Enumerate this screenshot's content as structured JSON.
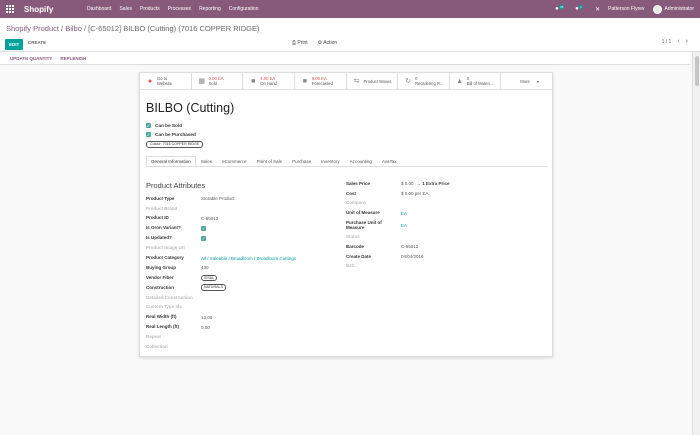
{
  "navbar": {
    "brand": "Shopify",
    "menu": [
      "Dashboard",
      "Sales",
      "Products",
      "Processes",
      "Reporting",
      "Configuration"
    ],
    "messages_count": "26",
    "activities_count": "1",
    "company": "Patterson Flyrev",
    "user": "Administrator"
  },
  "breadcrumb": {
    "root": "Shopify Product",
    "sep1": " / ",
    "parent": "Bilbo",
    "sep2": " / ",
    "current": "[C-65012] BILBO (Cutting) (7016 COPPER RIDGE)"
  },
  "toolbar": {
    "edit_label": "EDIT",
    "create_label": "CREATE",
    "print_label": "Print",
    "action_label": "Action",
    "pager": "1 / 1"
  },
  "statusbar": {
    "update_quantity": "UPDATE QUANTITY",
    "replenish": "REPLENISH"
  },
  "smart_buttons": [
    {
      "value": "Go to",
      "label": "Website"
    },
    {
      "value": "0.00 EA",
      "label": "Sold"
    },
    {
      "value": "4.00 EA",
      "label": "On Hand"
    },
    {
      "value": "0.00 EA",
      "label": "Forecasted"
    },
    {
      "value": "",
      "label": "Product Moves"
    },
    {
      "value": "0",
      "label": "Reordering R..."
    },
    {
      "value": "0",
      "label": "Bill of Materi..."
    },
    {
      "value": "More",
      "label": ""
    }
  ],
  "product": {
    "name": "BILBO (Cutting)",
    "can_be_sold": "Can be Sold",
    "can_be_purchased": "Can be Purchased",
    "colour_tag": "Colour: 7016 COPPER RIDGE"
  },
  "tabs": [
    "General Information",
    "Sales",
    "eCommerce",
    "Point of Sale",
    "Purchase",
    "Inventory",
    "Accounting",
    "AvaTax"
  ],
  "attributes": {
    "section_title": "Product Attributes",
    "left": [
      {
        "label": "Product Type",
        "value": "Storable Product"
      },
      {
        "label": "Product Brand",
        "value": ""
      },
      {
        "label": "Product ID",
        "value": "C-65012"
      },
      {
        "label": "Is Oron Variant?",
        "value": "checked"
      },
      {
        "label": "Is Updated?",
        "value": "checked"
      },
      {
        "label": "Product Image Url",
        "value": ""
      },
      {
        "label": "Product Category",
        "value": "All / Saleable / Broadloom / Broadloom Cuttings"
      },
      {
        "label": "Buying Group",
        "value": "430"
      },
      {
        "label": "Vendor Fiber",
        "value": "SISAL"
      },
      {
        "label": "Construction",
        "value": "NATURALS"
      },
      {
        "label": "Detailed Construction",
        "value": ""
      },
      {
        "label": "Custom Type Ids",
        "value": ""
      },
      {
        "label": "Real Width (ft)",
        "value": "13.00"
      },
      {
        "label": "Real Length (ft)",
        "value": "0.00"
      },
      {
        "label": "Repeat",
        "value": ""
      },
      {
        "label": "Collection",
        "value": ""
      }
    ],
    "right": [
      {
        "label": "Sales Price",
        "value": "$ 0.00",
        "extra": "→ 1 Extra Price"
      },
      {
        "label": "Cost",
        "value": "$ 0.00 per EA"
      },
      {
        "label": "Company",
        "value": ""
      },
      {
        "label": "Unit of Measure",
        "value": "EA"
      },
      {
        "label": "Purchase Unit of Measure",
        "value": "EA"
      },
      {
        "label": "Status",
        "value": ""
      },
      {
        "label": "Barcode",
        "value": "C-65012"
      },
      {
        "label": "Create Date",
        "value": "04/04/2016"
      },
      {
        "label": "B2C",
        "value": ""
      }
    ]
  }
}
